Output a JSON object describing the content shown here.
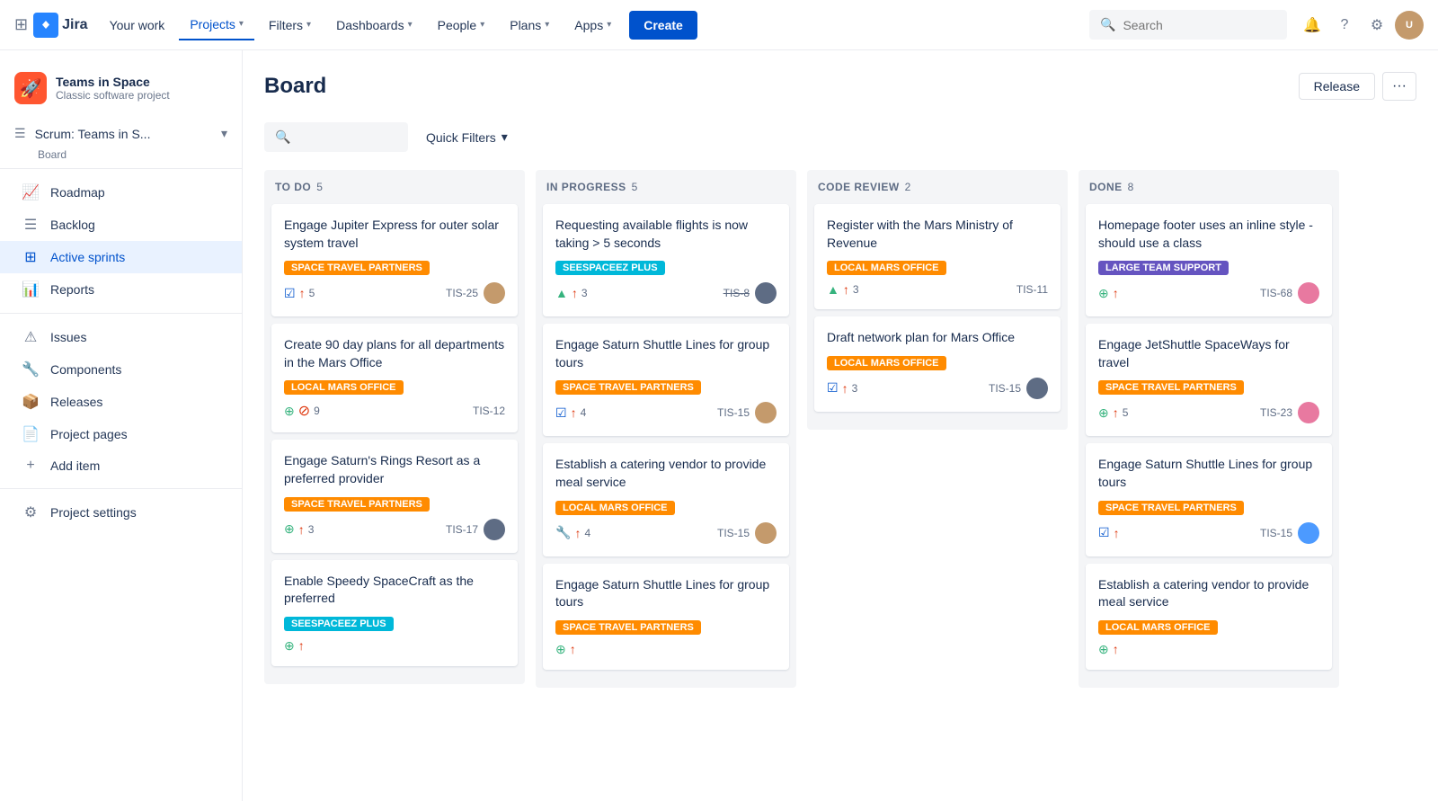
{
  "topnav": {
    "logo_text": "Jira",
    "nav_items": [
      {
        "label": "Your work",
        "active": false
      },
      {
        "label": "Projects",
        "active": true,
        "has_chevron": true
      },
      {
        "label": "Filters",
        "active": false,
        "has_chevron": true
      },
      {
        "label": "Dashboards",
        "active": false,
        "has_chevron": true
      },
      {
        "label": "People",
        "active": false,
        "has_chevron": true
      },
      {
        "label": "Plans",
        "active": false,
        "has_chevron": true
      },
      {
        "label": "Apps",
        "active": false,
        "has_chevron": true
      }
    ],
    "create_label": "Create",
    "search_placeholder": "Search"
  },
  "sidebar": {
    "project_name": "Teams in Space",
    "project_type": "Classic software project",
    "board_label": "Scrum: Teams in S...",
    "board_sub": "Board",
    "items": [
      {
        "label": "Roadmap",
        "icon": "📈",
        "active": false
      },
      {
        "label": "Backlog",
        "icon": "☰",
        "active": false
      },
      {
        "label": "Active sprints",
        "icon": "⊞",
        "active": true
      },
      {
        "label": "Reports",
        "icon": "📊",
        "active": false
      },
      {
        "label": "Issues",
        "icon": "⚠",
        "active": false
      },
      {
        "label": "Components",
        "icon": "🔧",
        "active": false
      },
      {
        "label": "Releases",
        "icon": "📦",
        "active": false
      },
      {
        "label": "Project pages",
        "icon": "📄",
        "active": false
      },
      {
        "label": "Add item",
        "icon": "+",
        "active": false
      },
      {
        "label": "Project settings",
        "icon": "⚙",
        "active": false
      }
    ]
  },
  "board": {
    "title": "Board",
    "release_label": "Release",
    "more_label": "···",
    "quick_filters_label": "Quick Filters",
    "columns": [
      {
        "title": "TO DO",
        "count": 5,
        "cards": [
          {
            "title": "Engage Jupiter Express for outer solar system travel",
            "tag": "SPACE TRAVEL PARTNERS",
            "tag_class": "tag-orange",
            "story_icon": "✓",
            "priority": "↑",
            "count": "5",
            "id": "TIS-25",
            "avatar": "av-brown",
            "id_strikethrough": false
          },
          {
            "title": "Create 90 day plans for all departments in the Mars Office",
            "tag": "LOCAL MARS OFFICE",
            "tag_class": "tag-orange",
            "story_icon": "+",
            "priority": "⊘",
            "count": "9",
            "id": "TIS-12",
            "avatar": null,
            "id_strikethrough": false
          },
          {
            "title": "Engage Saturn's Rings Resort as a preferred provider",
            "tag": "SPACE TRAVEL PARTNERS",
            "tag_class": "tag-orange",
            "story_icon": "+",
            "priority": "↑",
            "count": "3",
            "id": "TIS-17",
            "avatar": "av-dark",
            "id_strikethrough": false
          },
          {
            "title": "Enable Speedy SpaceCraft as the preferred",
            "tag": "SEESPACEEZ PLUS",
            "tag_class": "tag-blue",
            "story_icon": "+",
            "priority": "↑",
            "count": "",
            "id": "",
            "avatar": null,
            "id_strikethrough": false
          }
        ]
      },
      {
        "title": "IN PROGRESS",
        "count": 5,
        "cards": [
          {
            "title": "Requesting available flights is now taking > 5 seconds",
            "tag": "SEESPACEEZ PLUS",
            "tag_class": "tag-blue",
            "story_icon": "▲",
            "priority": "↑",
            "count": "3",
            "id": "TIS-8",
            "avatar": "av-dark",
            "id_strikethrough": true
          },
          {
            "title": "Engage Saturn Shuttle Lines for group tours",
            "tag": "SPACE TRAVEL PARTNERS",
            "tag_class": "tag-orange",
            "story_icon": "✓",
            "priority": "↑",
            "count": "4",
            "id": "TIS-15",
            "avatar": "av-brown",
            "id_strikethrough": false
          },
          {
            "title": "Establish a catering vendor to provide meal service",
            "tag": "LOCAL MARS OFFICE",
            "tag_class": "tag-orange",
            "story_icon": "🔧",
            "priority": "↑",
            "count": "4",
            "id": "TIS-15",
            "avatar": "av-brown",
            "id_strikethrough": false
          },
          {
            "title": "Engage Saturn Shuttle Lines for group tours",
            "tag": "SPACE TRAVEL PARTNERS",
            "tag_class": "tag-orange",
            "story_icon": "+",
            "priority": "↑",
            "count": "",
            "id": "",
            "avatar": null,
            "id_strikethrough": false
          }
        ]
      },
      {
        "title": "CODE REVIEW",
        "count": 2,
        "cards": [
          {
            "title": "Register with the Mars Ministry of Revenue",
            "tag": "LOCAL MARS OFFICE",
            "tag_class": "tag-orange",
            "story_icon": "▲",
            "priority": "↑",
            "count": "3",
            "id": "TIS-11",
            "avatar": null,
            "id_strikethrough": false
          },
          {
            "title": "Draft network plan for Mars Office",
            "tag": "LOCAL MARS OFFICE",
            "tag_class": "tag-orange",
            "story_icon": "✓",
            "priority": "↑",
            "count": "3",
            "id": "TIS-15",
            "avatar": "av-dark",
            "id_strikethrough": false
          }
        ]
      },
      {
        "title": "DONE",
        "count": 8,
        "cards": [
          {
            "title": "Homepage footer uses an inline style - should use a class",
            "tag": "LARGE TEAM SUPPORT",
            "tag_class": "tag-purple",
            "story_icon": "+",
            "priority": "↑",
            "count": "",
            "id": "TIS-68",
            "avatar": "av-pink",
            "id_strikethrough": false
          },
          {
            "title": "Engage JetShuttle SpaceWays for travel",
            "tag": "SPACE TRAVEL PARTNERS",
            "tag_class": "tag-orange",
            "story_icon": "+",
            "priority": "↑",
            "count": "5",
            "id": "TIS-23",
            "avatar": "av-pink",
            "id_strikethrough": false
          },
          {
            "title": "Engage Saturn Shuttle Lines for group tours",
            "tag": "SPACE TRAVEL PARTNERS",
            "tag_class": "tag-orange",
            "story_icon": "✓",
            "priority": "↑",
            "count": "",
            "id": "TIS-15",
            "avatar": "av-blue",
            "id_strikethrough": false
          },
          {
            "title": "Establish a catering vendor to provide meal service",
            "tag": "LOCAL MARS OFFICE",
            "tag_class": "tag-orange",
            "story_icon": "+",
            "priority": "↑",
            "count": "",
            "id": "",
            "avatar": null,
            "id_strikethrough": false
          }
        ]
      }
    ]
  }
}
